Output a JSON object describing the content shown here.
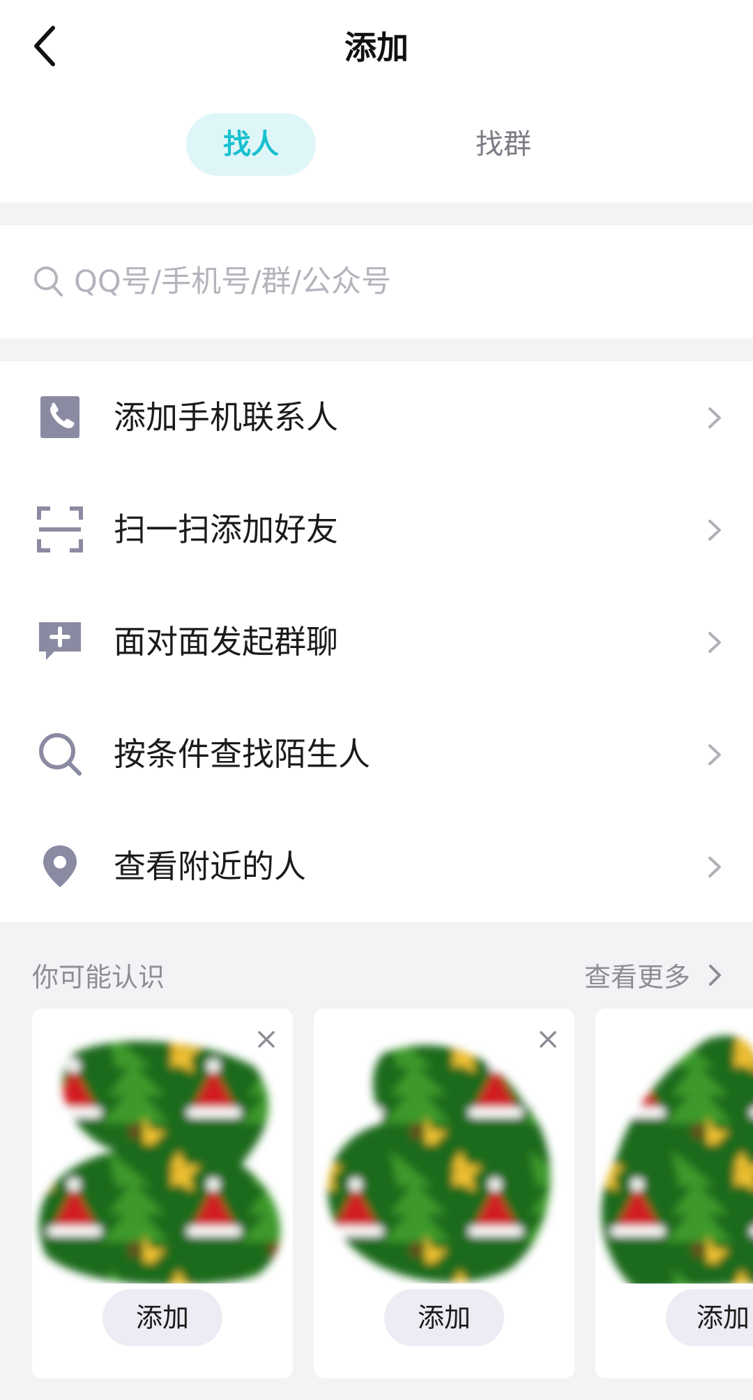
{
  "header": {
    "title": "添加"
  },
  "tabs": [
    {
      "label": "找人",
      "active": true
    },
    {
      "label": "找群",
      "active": false
    }
  ],
  "search": {
    "placeholder": "QQ号/手机号/群/公众号"
  },
  "menu": [
    {
      "label": "添加手机联系人",
      "icon": "phone-icon"
    },
    {
      "label": "扫一扫添加好友",
      "icon": "scan-icon"
    },
    {
      "label": "面对面发起群聊",
      "icon": "chat-plus-icon"
    },
    {
      "label": "按条件查找陌生人",
      "icon": "search-icon"
    },
    {
      "label": "查看附近的人",
      "icon": "location-pin-icon"
    }
  ],
  "recommend": {
    "title": "你可能认识",
    "more_label": "查看更多",
    "cards": [
      {
        "add_label": "添加"
      },
      {
        "add_label": "添加"
      },
      {
        "add_label": "添加"
      }
    ]
  },
  "colors": {
    "accent": "#19c0cf",
    "accent_bg": "#dff6f8",
    "icon": "#8a8aa2",
    "section_bg": "#f3f3f5"
  }
}
